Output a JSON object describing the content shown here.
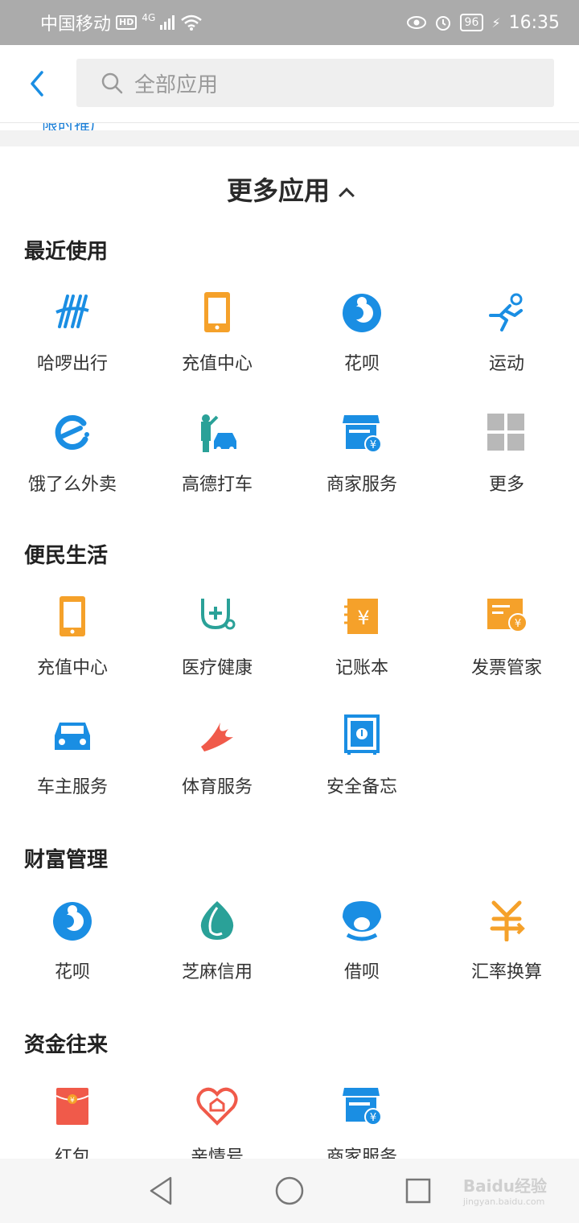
{
  "status_bar": {
    "carrier": "中国移动",
    "hd": "HD",
    "network": "4G",
    "battery": "96",
    "time": "16:35"
  },
  "search": {
    "placeholder": "全部应用"
  },
  "peek_text": "限时推广",
  "more_apps_title": "更多应用",
  "sections": {
    "recent": {
      "title": "最近使用",
      "items": [
        "哈啰出行",
        "充值中心",
        "花呗",
        "运动",
        "饿了么外卖",
        "高德打车",
        "商家服务",
        "更多"
      ]
    },
    "life": {
      "title": "便民生活",
      "items": [
        "充值中心",
        "医疗健康",
        "记账本",
        "发票管家",
        "车主服务",
        "体育服务",
        "安全备忘"
      ]
    },
    "wealth": {
      "title": "财富管理",
      "items": [
        "花呗",
        "芝麻信用",
        "借呗",
        "汇率换算"
      ]
    },
    "funds": {
      "title": "资金往来",
      "items": [
        "红包",
        "亲情号",
        "商家服务"
      ]
    }
  },
  "watermark": {
    "main": "Baidu经验",
    "sub": "jingyan.baidu.com"
  },
  "colors": {
    "blue": "#1a8ee3",
    "orange": "#f5a12a",
    "teal": "#2aa198",
    "red": "#f05a4a",
    "gray": "#b8b8b8"
  }
}
